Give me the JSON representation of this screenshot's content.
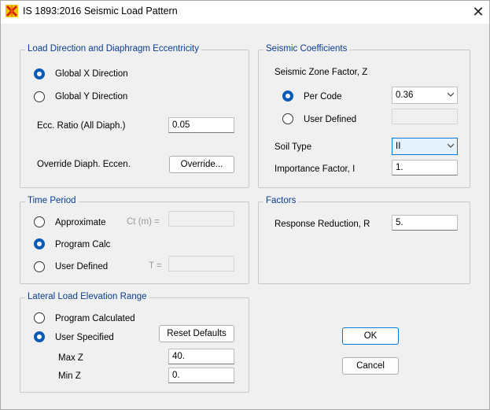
{
  "window": {
    "title": "IS 1893:2016 Seismic Load Pattern",
    "close": "✕"
  },
  "load_direction": {
    "legend": "Load Direction and Diaphragm Eccentricity",
    "global_x": "Global  X  Direction",
    "global_y": "Global  Y  Direction",
    "selected": "global_x",
    "ecc_ratio_label": "Ecc. Ratio (All Diaph.)",
    "ecc_ratio_value": "0.05",
    "override_label": "Override Diaph. Eccen.",
    "override_button": "Override..."
  },
  "time_period": {
    "legend": "Time Period",
    "approximate": "Approximate",
    "ct_label": "Ct (m) =",
    "program_calc": "Program Calc",
    "user_defined": "User Defined",
    "t_label": "T =",
    "selected": "program_calc"
  },
  "lateral_load": {
    "legend": "Lateral Load Elevation Range",
    "program_calculated": "Program Calculated",
    "user_specified": "User Specified",
    "selected": "user_specified",
    "reset_button": "Reset Defaults",
    "max_z_label": "Max Z",
    "max_z_value": "40.",
    "min_z_label": "Min Z",
    "min_z_value": "0."
  },
  "seismic_coefficients": {
    "legend": "Seismic Coefficients",
    "zone_label": "Seismic Zone Factor, Z",
    "per_code": "Per Code",
    "user_defined": "User Defined",
    "selected": "per_code",
    "zone_value": "0.36",
    "soil_type_label": "Soil Type",
    "soil_type_value": "II",
    "importance_label": "Importance Factor, I",
    "importance_value": "1."
  },
  "factors": {
    "legend": "Factors",
    "r_label": "Response Reduction, R",
    "r_value": "5."
  },
  "buttons": {
    "ok": "OK",
    "cancel": "Cancel"
  },
  "colors": {
    "accent": "#0a5ab8",
    "legend_text": "#0a3d91",
    "focus_border": "#0078d7"
  }
}
